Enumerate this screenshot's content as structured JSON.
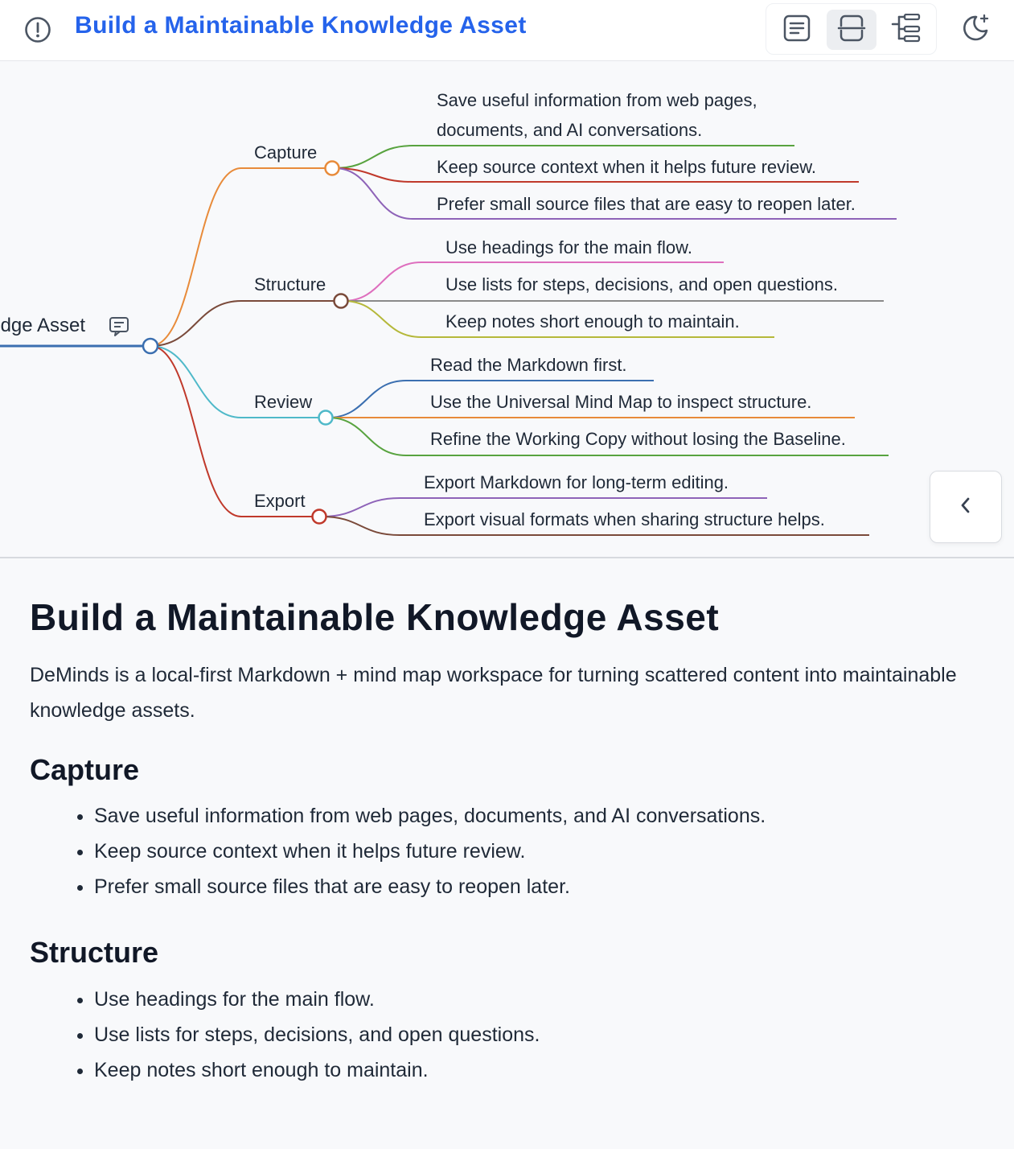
{
  "header": {
    "title": "Build a Maintainable Knowledge Asset",
    "view_buttons": [
      "document-view",
      "split-view",
      "mindmap-view"
    ],
    "active_view": "split-view"
  },
  "mindmap": {
    "root": "Build a Maintainable Knowledge Asset",
    "branches": [
      {
        "label": "Capture",
        "color": "#e88b3a",
        "children": [
          {
            "lines": [
              "Save useful information from web pages,",
              "documents, and AI conversations."
            ],
            "color": "#58a33f"
          },
          {
            "lines": [
              "Keep source context when it helps future review."
            ],
            "color": "#c0392b"
          },
          {
            "lines": [
              "Prefer small source files that are easy to reopen later."
            ],
            "color": "#8e63b8"
          }
        ]
      },
      {
        "label": "Structure",
        "color": "#7a4a3a",
        "children": [
          {
            "lines": [
              "Use headings for the main flow."
            ],
            "color": "#de6fbe"
          },
          {
            "lines": [
              "Use lists for steps, decisions, and open questions."
            ],
            "color": "#8a8a8a"
          },
          {
            "lines": [
              "Keep notes short enough to maintain."
            ],
            "color": "#b5b83a"
          }
        ]
      },
      {
        "label": "Review",
        "color": "#4fb9c9",
        "children": [
          {
            "lines": [
              "Read the Markdown first."
            ],
            "color": "#3b6fb0"
          },
          {
            "lines": [
              "Use the Universal Mind Map to inspect structure."
            ],
            "color": "#e88b3a"
          },
          {
            "lines": [
              "Refine the Working Copy without losing the Baseline."
            ],
            "color": "#58a33f"
          }
        ]
      },
      {
        "label": "Export",
        "color": "#c0392b",
        "children": [
          {
            "lines": [
              "Export Markdown for long-term editing."
            ],
            "color": "#8e63b8"
          },
          {
            "lines": [
              "Export visual formats when sharing structure helps."
            ],
            "color": "#7a4a3a"
          }
        ]
      }
    ],
    "root_color": "#3b6fb0"
  },
  "document": {
    "h1": "Build a Maintainable Knowledge Asset",
    "intro": "DeMinds is a local-first Markdown + mind map workspace for turning scattered content into maintainable knowledge assets.",
    "sections": [
      {
        "heading": "Capture",
        "items": [
          "Save useful information from web pages, documents, and AI conversations.",
          "Keep source context when it helps future review.",
          "Prefer small source files that are easy to reopen later."
        ]
      },
      {
        "heading": "Structure",
        "items": [
          "Use headings for the main flow.",
          "Use lists for steps, decisions, and open questions.",
          "Keep notes short enough to maintain."
        ]
      }
    ]
  }
}
